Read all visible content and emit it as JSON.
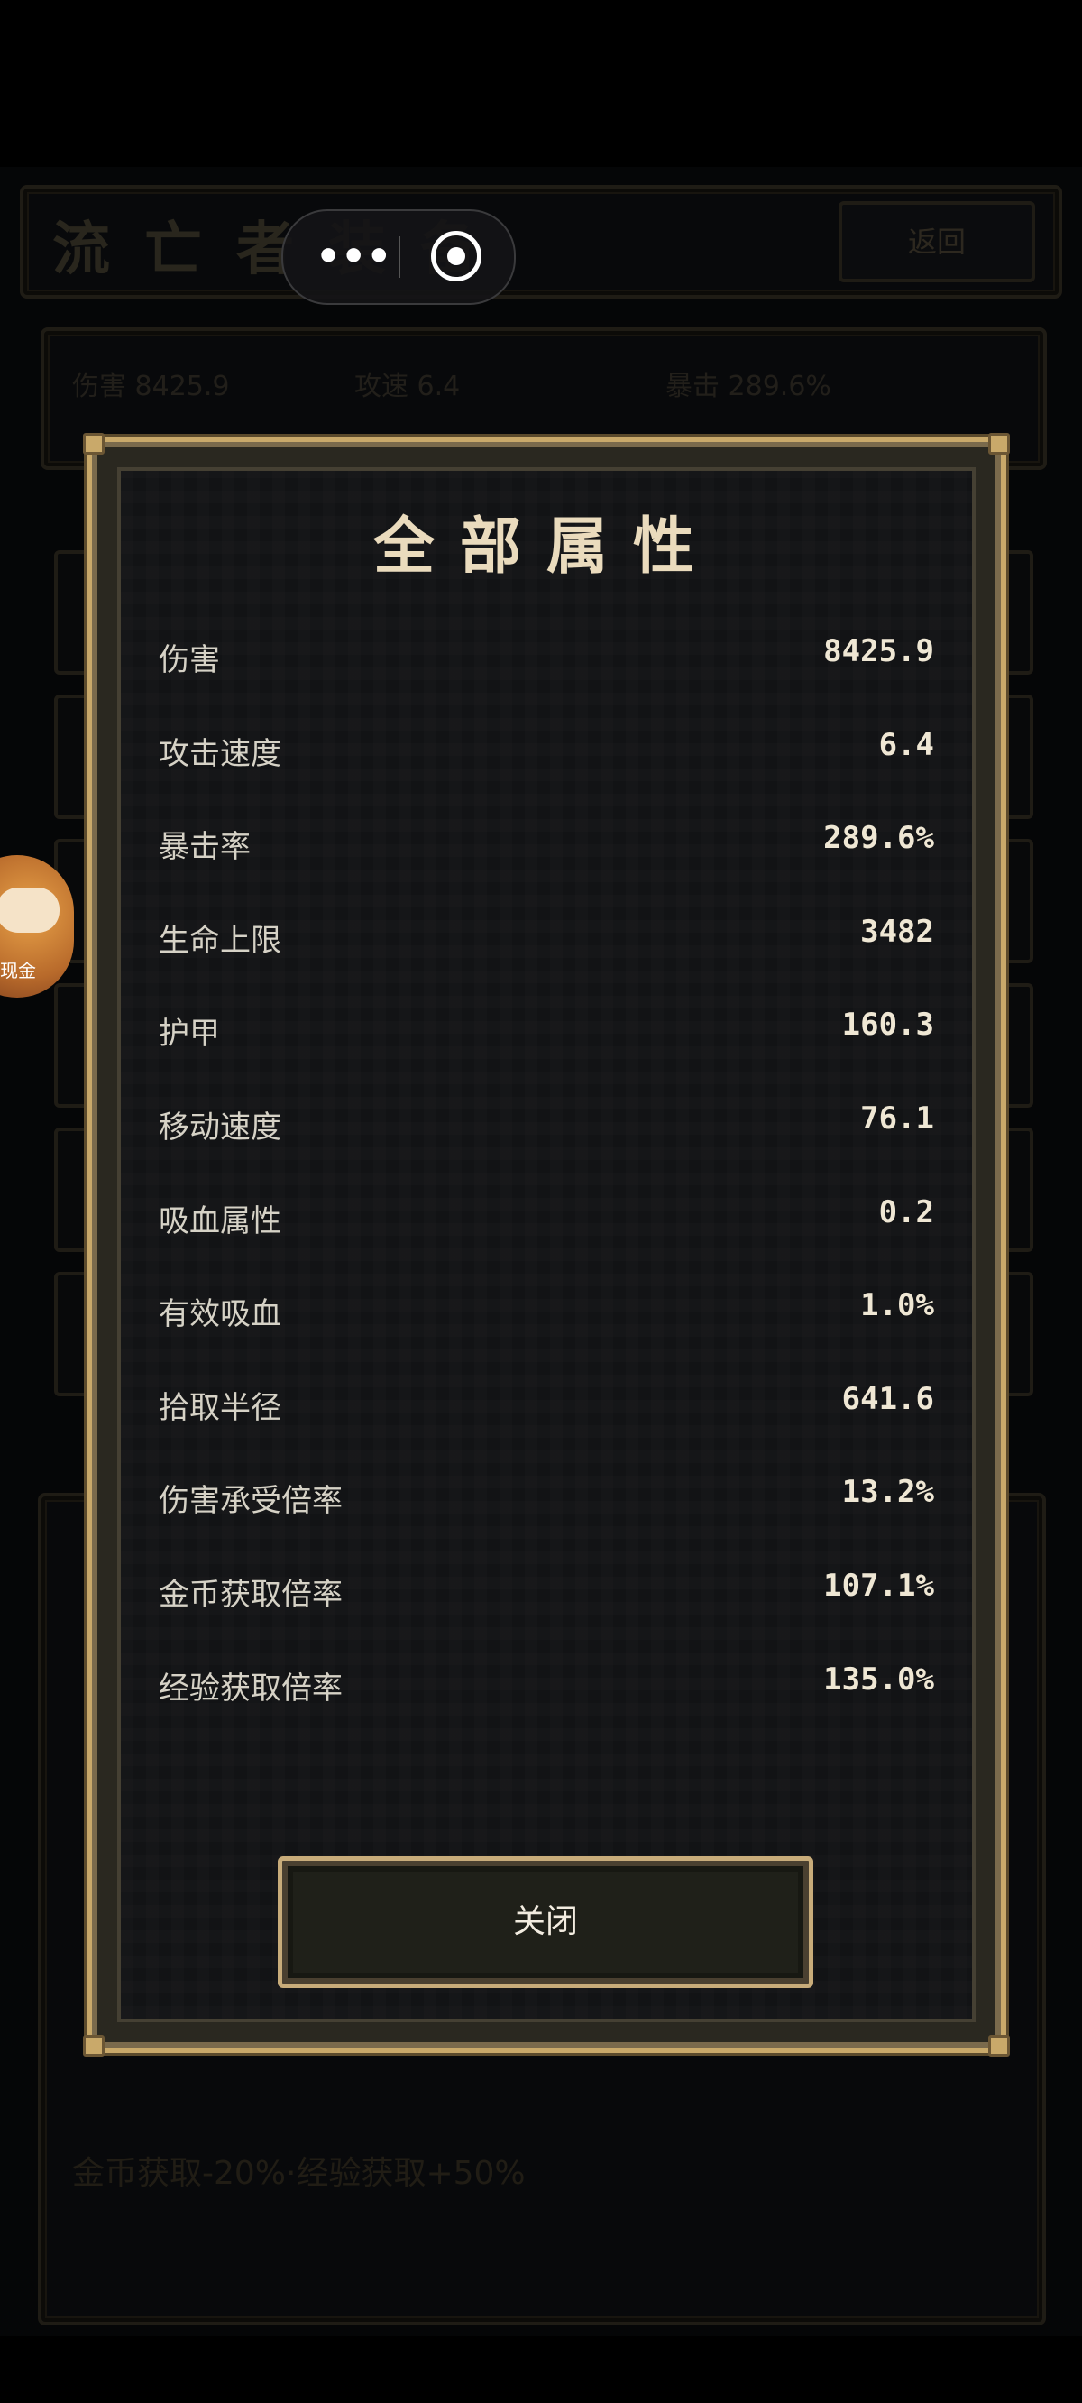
{
  "background": {
    "title": "流亡者装备",
    "back_label": "返回",
    "stats": [
      {
        "label": "伤害",
        "value": "8425.9"
      },
      {
        "label": "攻速",
        "value": "6.4"
      },
      {
        "label": "暴击",
        "value": "289.6%"
      }
    ],
    "bottom_note": "金币获取-20%·经验获取+50%"
  },
  "floating_avatar": {
    "label": "现金"
  },
  "modal": {
    "title": "全部属性",
    "attributes": [
      {
        "label": "伤害",
        "value": "8425.9"
      },
      {
        "label": "攻击速度",
        "value": "6.4"
      },
      {
        "label": "暴击率",
        "value": "289.6%"
      },
      {
        "label": "生命上限",
        "value": "3482"
      },
      {
        "label": "护甲",
        "value": "160.3"
      },
      {
        "label": "移动速度",
        "value": "76.1"
      },
      {
        "label": "吸血属性",
        "value": "0.2"
      },
      {
        "label": "有效吸血",
        "value": "1.0%"
      },
      {
        "label": "拾取半径",
        "value": "641.6"
      },
      {
        "label": "伤害承受倍率",
        "value": "13.2%"
      },
      {
        "label": "金币获取倍率",
        "value": "107.1%"
      },
      {
        "label": "经验获取倍率",
        "value": "135.0%"
      }
    ],
    "close_label": "关闭"
  }
}
